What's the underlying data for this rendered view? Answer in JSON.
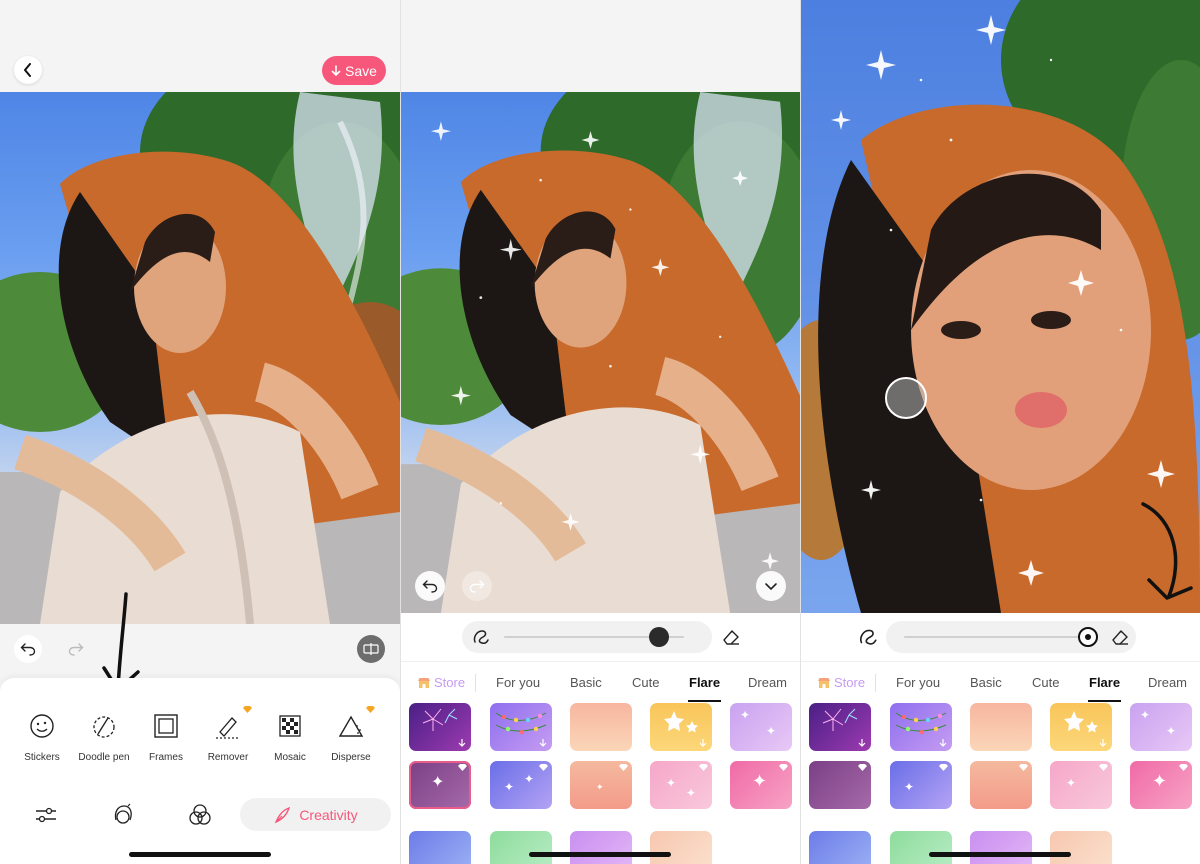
{
  "panel1": {
    "save_label": "Save",
    "tools": [
      {
        "label": "Stickers",
        "icon": "sticker-icon",
        "premium": false
      },
      {
        "label": "Doodle pen",
        "icon": "doodle-pen-icon",
        "premium": false
      },
      {
        "label": "Frames",
        "icon": "frames-icon",
        "premium": false
      },
      {
        "label": "Remover",
        "icon": "eraser-brush-icon",
        "premium": true
      },
      {
        "label": "Mosaic",
        "icon": "mosaic-icon",
        "premium": false
      },
      {
        "label": "Disperse",
        "icon": "disperse-icon",
        "premium": true
      }
    ],
    "nav": [
      "sliders-icon",
      "face-retouch-icon",
      "filters-icon"
    ],
    "creativity_label": "Creativity"
  },
  "brush_tabs": {
    "store_label": "Store",
    "items": [
      "For you",
      "Basic",
      "Cute",
      "Flare",
      "Dream"
    ],
    "active": "Flare"
  },
  "brush_size": {
    "panel2": 0.86,
    "panel3": 0.97
  },
  "colors": {
    "accent": "#f7577b",
    "store": "#c79bf2"
  }
}
